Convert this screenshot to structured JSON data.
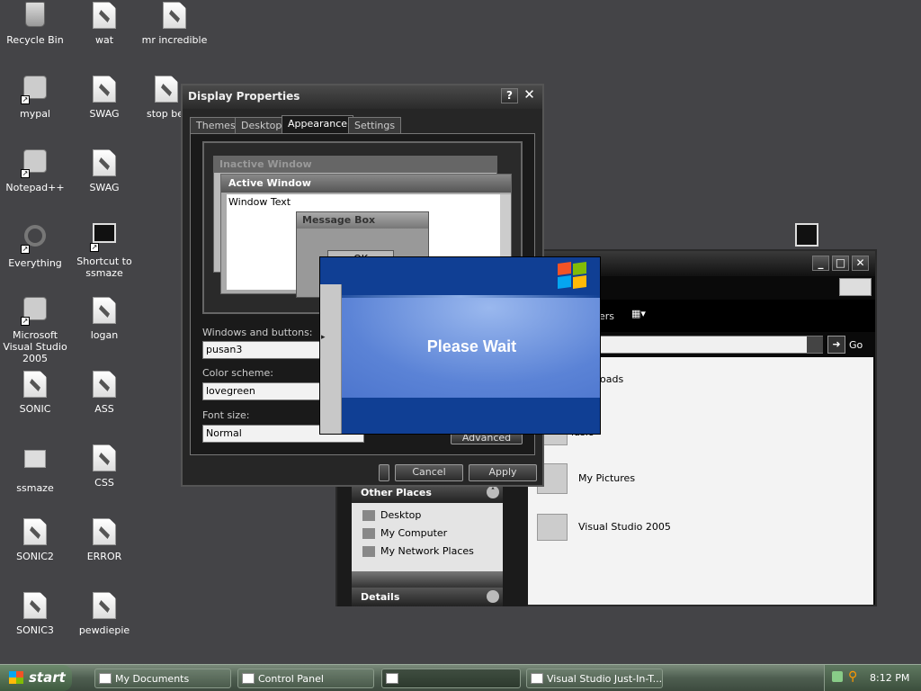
{
  "desktop_icons": [
    {
      "label": "Recycle Bin",
      "icon": "recycle-bin-icon"
    },
    {
      "label": "wat",
      "icon": "file-icon"
    },
    {
      "label": "mr incredible",
      "icon": "file-icon"
    },
    {
      "label": "mypal",
      "icon": "raccoon-icon"
    },
    {
      "label": "SWAG",
      "icon": "image-file-icon"
    },
    {
      "label": "stop be",
      "icon": "zip-file-icon"
    },
    {
      "label": "Notepad++",
      "icon": "notepad-icon"
    },
    {
      "label": "SWAG",
      "icon": "file-icon"
    },
    {
      "label": "Everything",
      "icon": "search-icon"
    },
    {
      "label": "Shortcut to ssmaze",
      "icon": "app-icon"
    },
    {
      "label": "Microsoft Visual Studio 2005",
      "icon": "visual-studio-icon"
    },
    {
      "label": "logan",
      "icon": "file-icon"
    },
    {
      "label": "SONIC",
      "icon": "file-icon"
    },
    {
      "label": "ASS",
      "icon": "file-icon"
    },
    {
      "label": "ssmaze",
      "icon": "folder-icon"
    },
    {
      "label": "CSS",
      "icon": "file-icon"
    },
    {
      "label": "SONIC2",
      "icon": "file-icon"
    },
    {
      "label": "ERROR",
      "icon": "file-icon"
    },
    {
      "label": "SONIC3",
      "icon": "file-icon"
    },
    {
      "label": "pewdiepie",
      "icon": "file-icon"
    }
  ],
  "display_properties": {
    "title": "Display Properties",
    "help_btn": "?",
    "close_btn": "✕",
    "tabs": [
      "Themes",
      "Desktop",
      "Appearance",
      "Settings"
    ],
    "preview": {
      "inactive_title": "Inactive Window",
      "active_title": "Active Window",
      "window_text": "Window Text",
      "message_title": "Message Box",
      "ok": "OK"
    },
    "windows_buttons_label": "Windows and buttons:",
    "windows_buttons_value": "pusan3",
    "color_scheme_label": "Color scheme:",
    "color_scheme_value": "lovegreen",
    "font_size_label": "Font size:",
    "font_size_value": "Normal",
    "advanced": "Advanced",
    "cancel": "Cancel",
    "apply": "Apply"
  },
  "explorer": {
    "toolbar_text": "ers",
    "go": "Go",
    "other_places_title": "Other Places",
    "other_places": [
      "Desktop",
      "My Computer",
      "My Network Places"
    ],
    "details_title": "Details",
    "folders": [
      "nloads",
      "lusic",
      "My Pictures",
      "Visual Studio 2005"
    ]
  },
  "splash": {
    "text": "Please Wait"
  },
  "taskbar": {
    "start": "start",
    "items": [
      "My Documents",
      "Control Panel",
      "",
      "Visual Studio Just-In-T..."
    ],
    "clock": "8:12 PM"
  }
}
